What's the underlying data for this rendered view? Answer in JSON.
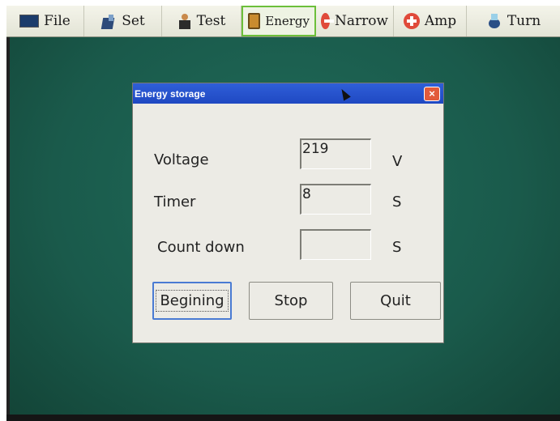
{
  "toolbar": {
    "items": [
      {
        "label": "File",
        "icon": "monitor-icon"
      },
      {
        "label": "Set",
        "icon": "settings-icon"
      },
      {
        "label": "Test",
        "icon": "person-icon"
      },
      {
        "label": "Energy",
        "icon": "battery-book-icon",
        "active": true
      },
      {
        "label": "Narrow",
        "icon": "minus-circle-icon"
      },
      {
        "label": "Amp",
        "icon": "plus-circle-icon"
      },
      {
        "label": "Turn",
        "icon": "rotate-icon"
      }
    ]
  },
  "dialog": {
    "title": "Energy storage",
    "close_label": "×",
    "fields": [
      {
        "label": "Voltage",
        "value": "219",
        "unit": "V"
      },
      {
        "label": "Timer",
        "value": "8",
        "unit": "S"
      },
      {
        "label": "Count down",
        "value": "",
        "unit": "S"
      }
    ],
    "buttons": {
      "begin": "Begining",
      "stop": "Stop",
      "quit": "Quit"
    }
  },
  "colors": {
    "desktop": "#1a5a4b",
    "titlebar": "#1f48c2",
    "close": "#e25b3b",
    "active_border": "#6cbf3a"
  }
}
